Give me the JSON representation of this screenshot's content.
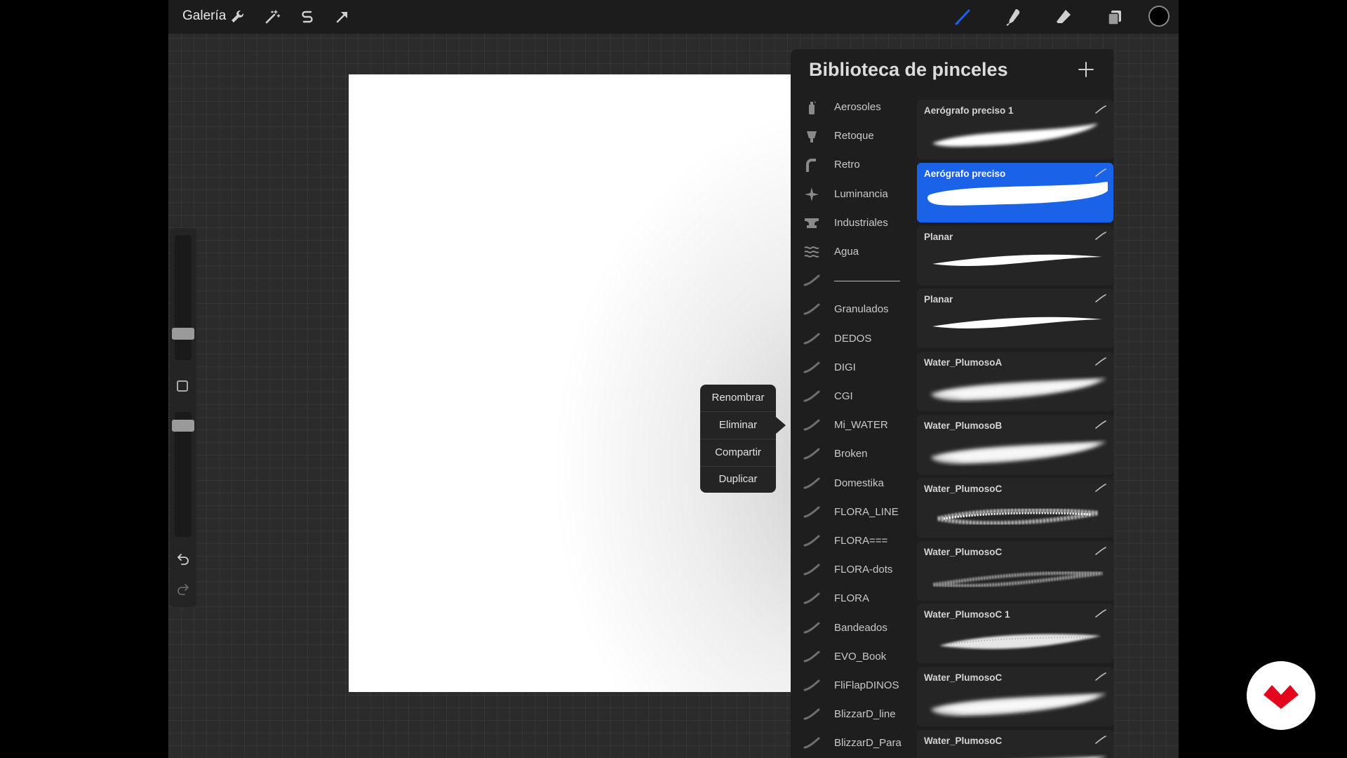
{
  "topbar": {
    "gallery_label": "Galería",
    "left_icons": [
      "wrench-icon",
      "magic-wand-icon",
      "selection-s-icon",
      "transform-arrow-icon"
    ],
    "right_icons": [
      "brush-icon",
      "smudge-icon",
      "eraser-icon",
      "layers-icon"
    ],
    "active_tool_color": "#1a63e8",
    "current_color": "#000000"
  },
  "sidebar": {
    "controls": [
      "brush-size-slider",
      "modify-button",
      "opacity-slider",
      "undo-icon",
      "redo-icon"
    ]
  },
  "library": {
    "title": "Biblioteca de pinceles",
    "add_icon": "plus-icon",
    "sets": [
      {
        "label": "Aerosoles",
        "icon": "spray-can-icon"
      },
      {
        "label": "Retoque",
        "icon": "retouch-icon"
      },
      {
        "label": "Retro",
        "icon": "retro-icon"
      },
      {
        "label": "Luminancia",
        "icon": "sparkle-icon"
      },
      {
        "label": "Industriales",
        "icon": "anvil-icon"
      },
      {
        "label": "Agua",
        "icon": "waves-icon"
      },
      {
        "label": "",
        "icon": "brush-stroke-icon",
        "separator": true
      },
      {
        "label": "Granulados",
        "icon": "brush-stroke-icon"
      },
      {
        "label": "DEDOS",
        "icon": "brush-stroke-icon"
      },
      {
        "label": "DIGI",
        "icon": "brush-stroke-icon"
      },
      {
        "label": "CGI",
        "icon": "brush-stroke-icon"
      },
      {
        "label": "Mi_WATER",
        "icon": "brush-stroke-icon"
      },
      {
        "label": "Broken",
        "icon": "brush-stroke-icon"
      },
      {
        "label": "Domestika",
        "icon": "brush-stroke-icon"
      },
      {
        "label": "FLORA_LINE",
        "icon": "brush-stroke-icon"
      },
      {
        "label": "FLORA===",
        "icon": "brush-stroke-icon"
      },
      {
        "label": "FLORA-dots",
        "icon": "brush-stroke-icon"
      },
      {
        "label": "FLORA",
        "icon": "brush-stroke-icon"
      },
      {
        "label": "Bandeados",
        "icon": "brush-stroke-icon"
      },
      {
        "label": "EVO_Book",
        "icon": "brush-stroke-icon"
      },
      {
        "label": "FliFlapDINOS",
        "icon": "brush-stroke-icon"
      },
      {
        "label": "BlizzarD_line",
        "icon": "brush-stroke-icon"
      },
      {
        "label": "BlizzarD_Para",
        "icon": "brush-stroke-icon"
      }
    ],
    "brushes": [
      {
        "name": "Aerógrafo preciso 1",
        "stroke": "airbrush",
        "selected": false
      },
      {
        "name": "Aerógrafo preciso",
        "stroke": "airbrush-solid",
        "selected": true
      },
      {
        "name": "Planar",
        "stroke": "taper",
        "selected": false
      },
      {
        "name": "Planar",
        "stroke": "taper",
        "selected": false
      },
      {
        "name": "Water_PlumosoA",
        "stroke": "fluffy",
        "selected": false
      },
      {
        "name": "Water_PlumosoB",
        "stroke": "fluffy",
        "selected": false
      },
      {
        "name": "Water_PlumosoC",
        "stroke": "textured",
        "selected": false
      },
      {
        "name": "Water_PlumosoC",
        "stroke": "textured-thin",
        "selected": false
      },
      {
        "name": "Water_PlumosoC 1",
        "stroke": "grainy",
        "selected": false
      },
      {
        "name": "Water_PlumosoC",
        "stroke": "fluffy",
        "selected": false
      },
      {
        "name": "Water_PlumosoC",
        "stroke": "fluffy",
        "selected": false
      }
    ]
  },
  "context_menu": {
    "items": [
      "Renombrar",
      "Eliminar",
      "Compartir",
      "Duplicar"
    ]
  },
  "logo": {
    "icon": "domestika-logo-icon",
    "color": "#e3051b"
  }
}
